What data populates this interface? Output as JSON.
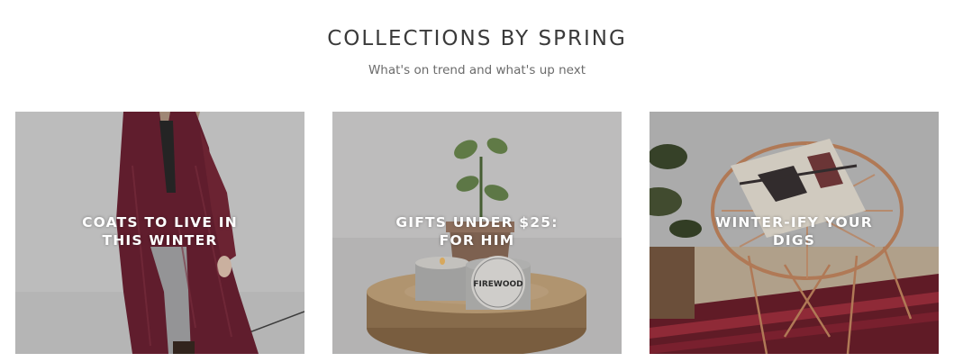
{
  "section": {
    "title": "COLLECTIONS BY SPRING",
    "subtitle": "What's on trend and what's up next"
  },
  "collections": [
    {
      "label_line1": "COATS TO LIVE IN",
      "label_line2": "THIS WINTER",
      "image": "woman-in-burgundy-coat"
    },
    {
      "label_line1": "GIFTS UNDER $25:",
      "label_line2": "FOR HIM",
      "image": "candle-tins-and-plant-on-wood-slice",
      "candle_label": "FIREWOOD"
    },
    {
      "label_line1": "WINTER-IFY YOUR",
      "label_line2": "DIGS",
      "image": "copper-chair-with-patterned-pillow"
    }
  ]
}
